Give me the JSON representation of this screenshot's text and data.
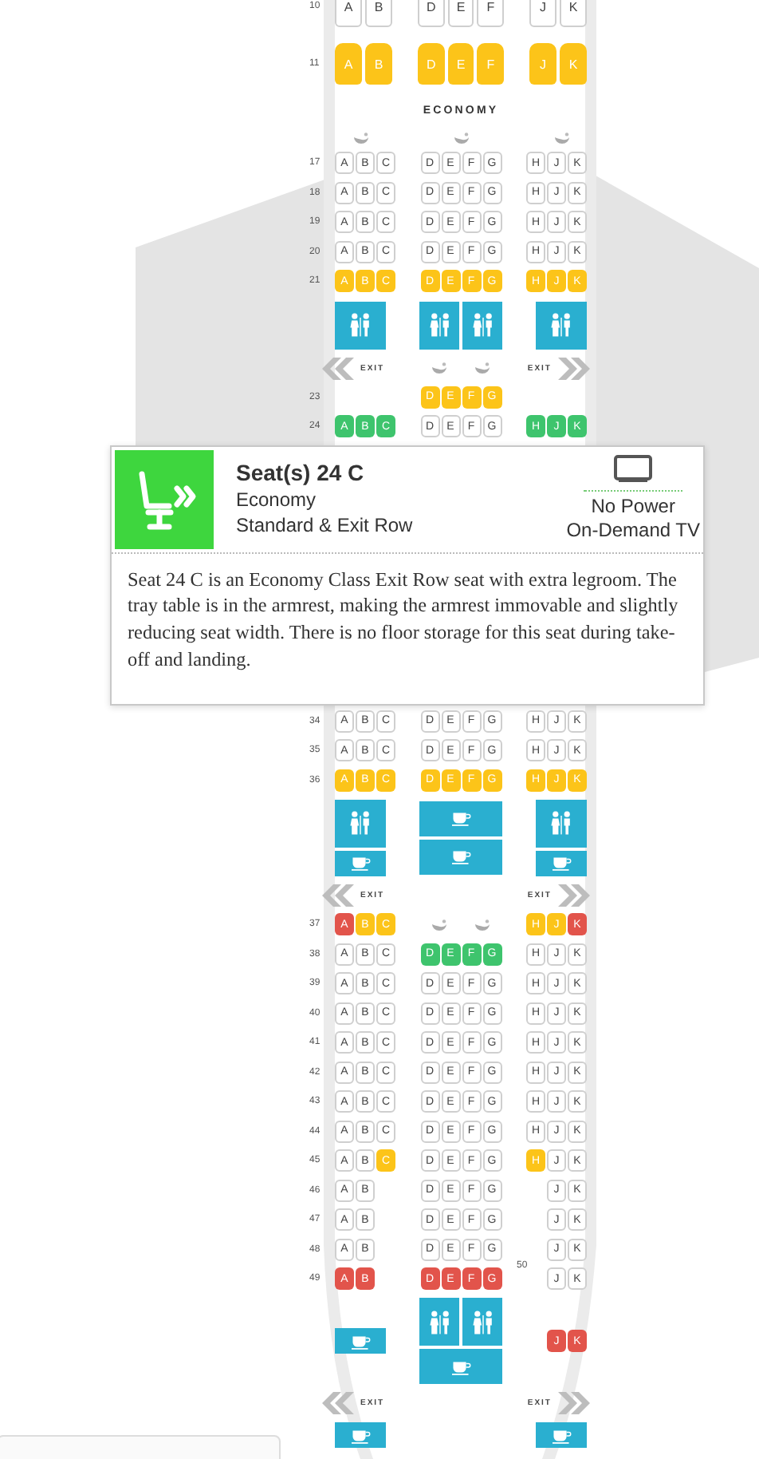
{
  "upper_rows": [
    {
      "kind": "premium",
      "label": "10",
      "left": {
        "seats": [
          {
            "letter": "A",
            "color": "#ffffff"
          },
          {
            "letter": "B",
            "color": "#ffffff"
          }
        ]
      },
      "center": {
        "seats": [
          {
            "letter": "D",
            "color": "#ffffff"
          },
          {
            "letter": "E",
            "color": "#ffffff"
          },
          {
            "letter": "F",
            "color": "#ffffff"
          }
        ]
      },
      "right": {
        "seats": [
          {
            "letter": "J",
            "color": "#ffffff"
          },
          {
            "letter": "K",
            "color": "#ffffff"
          }
        ]
      }
    },
    {
      "kind": "premium",
      "label": "11",
      "left": {
        "seats": [
          {
            "letter": "A",
            "color": "#fcc419"
          },
          {
            "letter": "B",
            "color": "#fcc419"
          }
        ]
      },
      "center": {
        "seats": [
          {
            "letter": "D",
            "color": "#fcc419"
          },
          {
            "letter": "E",
            "color": "#fcc419"
          },
          {
            "letter": "F",
            "color": "#fcc419"
          }
        ]
      },
      "right": {
        "seats": [
          {
            "letter": "J",
            "color": "#fcc419"
          },
          {
            "letter": "K",
            "color": "#fcc419"
          }
        ]
      }
    },
    {
      "kind": "cabin",
      "title": "ECONOMY"
    },
    {
      "kind": "fixtures",
      "left": {
        "blocks": [
          [
            {
              "kind": "bassinet"
            }
          ]
        ]
      },
      "center": {
        "blocks": [
          [
            {
              "kind": "bassinet"
            }
          ]
        ]
      },
      "right": {
        "blocks": [
          [
            {
              "kind": "bassinet"
            }
          ]
        ]
      }
    },
    {
      "kind": "seats",
      "label": "17",
      "left": {
        "seats": [
          {
            "letter": "A",
            "color": "#ffffff"
          },
          {
            "letter": "B",
            "color": "#ffffff"
          },
          {
            "letter": "C",
            "color": "#ffffff"
          }
        ]
      },
      "center": {
        "seats": [
          {
            "letter": "D",
            "color": "#ffffff"
          },
          {
            "letter": "E",
            "color": "#ffffff"
          },
          {
            "letter": "F",
            "color": "#ffffff"
          },
          {
            "letter": "G",
            "color": "#ffffff"
          }
        ]
      },
      "right": {
        "seats": [
          {
            "letter": "H",
            "color": "#ffffff"
          },
          {
            "letter": "J",
            "color": "#ffffff"
          },
          {
            "letter": "K",
            "color": "#ffffff"
          }
        ]
      }
    },
    {
      "kind": "seats",
      "label": "18",
      "left": {
        "seats": [
          {
            "letter": "A",
            "color": "#ffffff"
          },
          {
            "letter": "B",
            "color": "#ffffff"
          },
          {
            "letter": "C",
            "color": "#ffffff"
          }
        ]
      },
      "center": {
        "seats": [
          {
            "letter": "D",
            "color": "#ffffff"
          },
          {
            "letter": "E",
            "color": "#ffffff"
          },
          {
            "letter": "F",
            "color": "#ffffff"
          },
          {
            "letter": "G",
            "color": "#ffffff"
          }
        ]
      },
      "right": {
        "seats": [
          {
            "letter": "H",
            "color": "#ffffff"
          },
          {
            "letter": "J",
            "color": "#ffffff"
          },
          {
            "letter": "K",
            "color": "#ffffff"
          }
        ]
      }
    },
    {
      "kind": "seats",
      "label": "19",
      "left": {
        "seats": [
          {
            "letter": "A",
            "color": "#ffffff"
          },
          {
            "letter": "B",
            "color": "#ffffff"
          },
          {
            "letter": "C",
            "color": "#ffffff"
          }
        ]
      },
      "center": {
        "seats": [
          {
            "letter": "D",
            "color": "#ffffff"
          },
          {
            "letter": "E",
            "color": "#ffffff"
          },
          {
            "letter": "F",
            "color": "#ffffff"
          },
          {
            "letter": "G",
            "color": "#ffffff"
          }
        ]
      },
      "right": {
        "seats": [
          {
            "letter": "H",
            "color": "#ffffff"
          },
          {
            "letter": "J",
            "color": "#ffffff"
          },
          {
            "letter": "K",
            "color": "#ffffff"
          }
        ]
      }
    },
    {
      "kind": "seats",
      "label": "20",
      "left": {
        "seats": [
          {
            "letter": "A",
            "color": "#ffffff"
          },
          {
            "letter": "B",
            "color": "#ffffff"
          },
          {
            "letter": "C",
            "color": "#ffffff"
          }
        ]
      },
      "center": {
        "seats": [
          {
            "letter": "D",
            "color": "#ffffff"
          },
          {
            "letter": "E",
            "color": "#ffffff"
          },
          {
            "letter": "F",
            "color": "#ffffff"
          },
          {
            "letter": "G",
            "color": "#ffffff"
          }
        ]
      },
      "right": {
        "seats": [
          {
            "letter": "H",
            "color": "#ffffff"
          },
          {
            "letter": "J",
            "color": "#ffffff"
          },
          {
            "letter": "K",
            "color": "#ffffff"
          }
        ]
      }
    },
    {
      "kind": "seats",
      "label": "21",
      "left": {
        "seats": [
          {
            "letter": "A",
            "color": "#fcc419"
          },
          {
            "letter": "B",
            "color": "#fcc419"
          },
          {
            "letter": "C",
            "color": "#fcc419"
          }
        ]
      },
      "center": {
        "seats": [
          {
            "letter": "D",
            "color": "#fcc419"
          },
          {
            "letter": "E",
            "color": "#fcc419"
          },
          {
            "letter": "F",
            "color": "#fcc419"
          },
          {
            "letter": "G",
            "color": "#fcc419"
          }
        ]
      },
      "right": {
        "seats": [
          {
            "letter": "H",
            "color": "#fcc419"
          },
          {
            "letter": "J",
            "color": "#fcc419"
          },
          {
            "letter": "K",
            "color": "#fcc419"
          }
        ]
      }
    },
    {
      "kind": "fixtures",
      "left": {
        "blocks": [
          [
            {
              "kind": "lavatory"
            }
          ]
        ]
      },
      "center": {
        "blocks": [
          [
            {
              "kind": "lavatory"
            },
            {
              "kind": "lavatory"
            }
          ]
        ]
      },
      "right": {
        "blocks": [
          [
            {
              "kind": "lavatory"
            }
          ]
        ]
      }
    },
    {
      "kind": "exit",
      "left_text": "EXIT",
      "right_text": "EXIT",
      "center": {
        "blocks": [
          [
            {
              "kind": "bassinet"
            },
            {
              "kind": "bassinet"
            }
          ]
        ]
      }
    },
    {
      "kind": "seats",
      "label": "23",
      "center": {
        "seats": [
          {
            "letter": "D",
            "color": "#fcc419"
          },
          {
            "letter": "E",
            "color": "#fcc419"
          },
          {
            "letter": "F",
            "color": "#fcc419"
          },
          {
            "letter": "G",
            "color": "#fcc419"
          }
        ]
      }
    },
    {
      "kind": "seats",
      "label": "24",
      "left": {
        "seats": [
          {
            "letter": "A",
            "color": "#3ec46d"
          },
          {
            "letter": "B",
            "color": "#3ec46d"
          },
          {
            "letter": "C",
            "color": "#3ec46d"
          }
        ]
      },
      "center": {
        "seats": [
          {
            "letter": "D",
            "color": "#ffffff"
          },
          {
            "letter": "E",
            "color": "#ffffff"
          },
          {
            "letter": "F",
            "color": "#ffffff"
          },
          {
            "letter": "G",
            "color": "#ffffff"
          }
        ]
      },
      "right": {
        "seats": [
          {
            "letter": "H",
            "color": "#3ec46d"
          },
          {
            "letter": "J",
            "color": "#3ec46d"
          },
          {
            "letter": "K",
            "color": "#3ec46d"
          }
        ]
      }
    }
  ],
  "seat_details": {
    "color": "#3ed63e",
    "title": "Seat(s) 24 C",
    "cabin": "Economy",
    "seat_type": "Standard & Exit Row",
    "amenities": [
      "No Power",
      "On-Demand TV"
    ],
    "description": "Seat 24 C is an Economy Class Exit Row seat with extra legroom. The tray table is in the armrest, making the armrest immovable and slightly reducing seat width. There is no floor storage for this seat during take-off and landing."
  },
  "lower_rows": [
    {
      "kind": "seats",
      "label": "34",
      "left": {
        "seats": [
          {
            "letter": "A",
            "color": "#ffffff"
          },
          {
            "letter": "B",
            "color": "#ffffff"
          },
          {
            "letter": "C",
            "color": "#ffffff"
          }
        ]
      },
      "center": {
        "seats": [
          {
            "letter": "D",
            "color": "#ffffff"
          },
          {
            "letter": "E",
            "color": "#ffffff"
          },
          {
            "letter": "F",
            "color": "#ffffff"
          },
          {
            "letter": "G",
            "color": "#ffffff"
          }
        ]
      },
      "right": {
        "seats": [
          {
            "letter": "H",
            "color": "#ffffff"
          },
          {
            "letter": "J",
            "color": "#ffffff"
          },
          {
            "letter": "K",
            "color": "#ffffff"
          }
        ]
      }
    },
    {
      "kind": "seats",
      "label": "35",
      "left": {
        "seats": [
          {
            "letter": "A",
            "color": "#ffffff"
          },
          {
            "letter": "B",
            "color": "#ffffff"
          },
          {
            "letter": "C",
            "color": "#ffffff"
          }
        ]
      },
      "center": {
        "seats": [
          {
            "letter": "D",
            "color": "#ffffff"
          },
          {
            "letter": "E",
            "color": "#ffffff"
          },
          {
            "letter": "F",
            "color": "#ffffff"
          },
          {
            "letter": "G",
            "color": "#ffffff"
          }
        ]
      },
      "right": {
        "seats": [
          {
            "letter": "H",
            "color": "#ffffff"
          },
          {
            "letter": "J",
            "color": "#ffffff"
          },
          {
            "letter": "K",
            "color": "#ffffff"
          }
        ]
      }
    },
    {
      "kind": "seats",
      "label": "36",
      "left": {
        "seats": [
          {
            "letter": "A",
            "color": "#fcc419"
          },
          {
            "letter": "B",
            "color": "#fcc419"
          },
          {
            "letter": "C",
            "color": "#fcc419"
          }
        ]
      },
      "center": {
        "seats": [
          {
            "letter": "D",
            "color": "#fcc419"
          },
          {
            "letter": "E",
            "color": "#fcc419"
          },
          {
            "letter": "F",
            "color": "#fcc419"
          },
          {
            "letter": "G",
            "color": "#fcc419"
          }
        ]
      },
      "right": {
        "seats": [
          {
            "letter": "H",
            "color": "#fcc419"
          },
          {
            "letter": "J",
            "color": "#fcc419"
          },
          {
            "letter": "K",
            "color": "#fcc419"
          }
        ]
      }
    },
    {
      "kind": "fixtures",
      "left": {
        "blocks": [
          [
            {
              "kind": "lavatory"
            }
          ],
          [
            {
              "kind": "galley"
            }
          ]
        ]
      },
      "center": {
        "blocks": [
          [
            {
              "kind": "galley"
            }
          ],
          [
            {
              "kind": "galley"
            }
          ]
        ]
      },
      "right": {
        "blocks": [
          [
            {
              "kind": "lavatory"
            }
          ],
          [
            {
              "kind": "galley"
            }
          ]
        ]
      }
    },
    {
      "kind": "exit",
      "left_text": "EXIT",
      "right_text": "EXIT"
    },
    {
      "kind": "seats",
      "label": "37",
      "left": {
        "seats": [
          {
            "letter": "A",
            "color": "#e2544b"
          },
          {
            "letter": "B",
            "color": "#fcc419"
          },
          {
            "letter": "C",
            "color": "#fcc419"
          }
        ]
      },
      "center": {
        "blocks": [
          [
            {
              "kind": "bassinet"
            },
            {
              "kind": "bassinet"
            }
          ]
        ]
      },
      "right": {
        "seats": [
          {
            "letter": "H",
            "color": "#fcc419"
          },
          {
            "letter": "J",
            "color": "#fcc419"
          },
          {
            "letter": "K",
            "color": "#e2544b"
          }
        ]
      }
    },
    {
      "kind": "seats",
      "label": "38",
      "left": {
        "seats": [
          {
            "letter": "A",
            "color": "#ffffff"
          },
          {
            "letter": "B",
            "color": "#ffffff"
          },
          {
            "letter": "C",
            "color": "#ffffff"
          }
        ]
      },
      "center": {
        "seats": [
          {
            "letter": "D",
            "color": "#3ec46d"
          },
          {
            "letter": "E",
            "color": "#3ec46d"
          },
          {
            "letter": "F",
            "color": "#3ec46d"
          },
          {
            "letter": "G",
            "color": "#3ec46d"
          }
        ]
      },
      "right": {
        "seats": [
          {
            "letter": "H",
            "color": "#ffffff"
          },
          {
            "letter": "J",
            "color": "#ffffff"
          },
          {
            "letter": "K",
            "color": "#ffffff"
          }
        ]
      }
    },
    {
      "kind": "seats",
      "label": "39",
      "left": {
        "seats": [
          {
            "letter": "A",
            "color": "#ffffff"
          },
          {
            "letter": "B",
            "color": "#ffffff"
          },
          {
            "letter": "C",
            "color": "#ffffff"
          }
        ]
      },
      "center": {
        "seats": [
          {
            "letter": "D",
            "color": "#ffffff"
          },
          {
            "letter": "E",
            "color": "#ffffff"
          },
          {
            "letter": "F",
            "color": "#ffffff"
          },
          {
            "letter": "G",
            "color": "#ffffff"
          }
        ]
      },
      "right": {
        "seats": [
          {
            "letter": "H",
            "color": "#ffffff"
          },
          {
            "letter": "J",
            "color": "#ffffff"
          },
          {
            "letter": "K",
            "color": "#ffffff"
          }
        ]
      }
    },
    {
      "kind": "seats",
      "label": "40",
      "left": {
        "seats": [
          {
            "letter": "A",
            "color": "#ffffff"
          },
          {
            "letter": "B",
            "color": "#ffffff"
          },
          {
            "letter": "C",
            "color": "#ffffff"
          }
        ]
      },
      "center": {
        "seats": [
          {
            "letter": "D",
            "color": "#ffffff"
          },
          {
            "letter": "E",
            "color": "#ffffff"
          },
          {
            "letter": "F",
            "color": "#ffffff"
          },
          {
            "letter": "G",
            "color": "#ffffff"
          }
        ]
      },
      "right": {
        "seats": [
          {
            "letter": "H",
            "color": "#ffffff"
          },
          {
            "letter": "J",
            "color": "#ffffff"
          },
          {
            "letter": "K",
            "color": "#ffffff"
          }
        ]
      }
    },
    {
      "kind": "seats",
      "label": "41",
      "left": {
        "seats": [
          {
            "letter": "A",
            "color": "#ffffff"
          },
          {
            "letter": "B",
            "color": "#ffffff"
          },
          {
            "letter": "C",
            "color": "#ffffff"
          }
        ]
      },
      "center": {
        "seats": [
          {
            "letter": "D",
            "color": "#ffffff"
          },
          {
            "letter": "E",
            "color": "#ffffff"
          },
          {
            "letter": "F",
            "color": "#ffffff"
          },
          {
            "letter": "G",
            "color": "#ffffff"
          }
        ]
      },
      "right": {
        "seats": [
          {
            "letter": "H",
            "color": "#ffffff"
          },
          {
            "letter": "J",
            "color": "#ffffff"
          },
          {
            "letter": "K",
            "color": "#ffffff"
          }
        ]
      }
    },
    {
      "kind": "seats",
      "label": "42",
      "left": {
        "seats": [
          {
            "letter": "A",
            "color": "#ffffff"
          },
          {
            "letter": "B",
            "color": "#ffffff"
          },
          {
            "letter": "C",
            "color": "#ffffff"
          }
        ]
      },
      "center": {
        "seats": [
          {
            "letter": "D",
            "color": "#ffffff"
          },
          {
            "letter": "E",
            "color": "#ffffff"
          },
          {
            "letter": "F",
            "color": "#ffffff"
          },
          {
            "letter": "G",
            "color": "#ffffff"
          }
        ]
      },
      "right": {
        "seats": [
          {
            "letter": "H",
            "color": "#ffffff"
          },
          {
            "letter": "J",
            "color": "#ffffff"
          },
          {
            "letter": "K",
            "color": "#ffffff"
          }
        ]
      }
    },
    {
      "kind": "seats",
      "label": "43",
      "left": {
        "seats": [
          {
            "letter": "A",
            "color": "#ffffff"
          },
          {
            "letter": "B",
            "color": "#ffffff"
          },
          {
            "letter": "C",
            "color": "#ffffff"
          }
        ]
      },
      "center": {
        "seats": [
          {
            "letter": "D",
            "color": "#ffffff"
          },
          {
            "letter": "E",
            "color": "#ffffff"
          },
          {
            "letter": "F",
            "color": "#ffffff"
          },
          {
            "letter": "G",
            "color": "#ffffff"
          }
        ]
      },
      "right": {
        "seats": [
          {
            "letter": "H",
            "color": "#ffffff"
          },
          {
            "letter": "J",
            "color": "#ffffff"
          },
          {
            "letter": "K",
            "color": "#ffffff"
          }
        ]
      }
    },
    {
      "kind": "seats",
      "label": "44",
      "left": {
        "seats": [
          {
            "letter": "A",
            "color": "#ffffff"
          },
          {
            "letter": "B",
            "color": "#ffffff"
          },
          {
            "letter": "C",
            "color": "#ffffff"
          }
        ]
      },
      "center": {
        "seats": [
          {
            "letter": "D",
            "color": "#ffffff"
          },
          {
            "letter": "E",
            "color": "#ffffff"
          },
          {
            "letter": "F",
            "color": "#ffffff"
          },
          {
            "letter": "G",
            "color": "#ffffff"
          }
        ]
      },
      "right": {
        "seats": [
          {
            "letter": "H",
            "color": "#ffffff"
          },
          {
            "letter": "J",
            "color": "#ffffff"
          },
          {
            "letter": "K",
            "color": "#ffffff"
          }
        ]
      }
    },
    {
      "kind": "seats",
      "label": "45",
      "left": {
        "seats": [
          {
            "letter": "A",
            "color": "#ffffff"
          },
          {
            "letter": "B",
            "color": "#ffffff"
          },
          {
            "letter": "C",
            "color": "#fcc419"
          }
        ]
      },
      "center": {
        "seats": [
          {
            "letter": "D",
            "color": "#ffffff"
          },
          {
            "letter": "E",
            "color": "#ffffff"
          },
          {
            "letter": "F",
            "color": "#ffffff"
          },
          {
            "letter": "G",
            "color": "#ffffff"
          }
        ]
      },
      "right": {
        "seats": [
          {
            "letter": "H",
            "color": "#fcc419"
          },
          {
            "letter": "J",
            "color": "#ffffff"
          },
          {
            "letter": "K",
            "color": "#ffffff"
          }
        ]
      }
    },
    {
      "kind": "seats",
      "label": "46",
      "left": {
        "seats": [
          {
            "letter": "A",
            "color": "#ffffff"
          },
          {
            "letter": "B",
            "color": "#ffffff"
          }
        ]
      },
      "center": {
        "seats": [
          {
            "letter": "D",
            "color": "#ffffff"
          },
          {
            "letter": "E",
            "color": "#ffffff"
          },
          {
            "letter": "F",
            "color": "#ffffff"
          },
          {
            "letter": "G",
            "color": "#ffffff"
          }
        ]
      },
      "right": {
        "seats": [
          {
            "letter": "J",
            "color": "#ffffff"
          },
          {
            "letter": "K",
            "color": "#ffffff"
          }
        ]
      }
    },
    {
      "kind": "seats",
      "label": "47",
      "left": {
        "seats": [
          {
            "letter": "A",
            "color": "#ffffff"
          },
          {
            "letter": "B",
            "color": "#ffffff"
          }
        ]
      },
      "center": {
        "seats": [
          {
            "letter": "D",
            "color": "#ffffff"
          },
          {
            "letter": "E",
            "color": "#ffffff"
          },
          {
            "letter": "F",
            "color": "#ffffff"
          },
          {
            "letter": "G",
            "color": "#ffffff"
          }
        ]
      },
      "right": {
        "seats": [
          {
            "letter": "J",
            "color": "#ffffff"
          },
          {
            "letter": "K",
            "color": "#ffffff"
          }
        ]
      }
    },
    {
      "kind": "seats",
      "label": "48",
      "left": {
        "seats": [
          {
            "letter": "A",
            "color": "#ffffff"
          },
          {
            "letter": "B",
            "color": "#ffffff"
          }
        ]
      },
      "center": {
        "seats": [
          {
            "letter": "D",
            "color": "#ffffff"
          },
          {
            "letter": "E",
            "color": "#ffffff"
          },
          {
            "letter": "F",
            "color": "#ffffff"
          },
          {
            "letter": "G",
            "color": "#ffffff"
          }
        ]
      },
      "right": {
        "seats": [
          {
            "letter": "J",
            "color": "#ffffff"
          },
          {
            "letter": "K",
            "color": "#ffffff"
          }
        ]
      }
    },
    {
      "kind": "seats",
      "label": "49",
      "left": {
        "seats": [
          {
            "letter": "A",
            "color": "#e2544b"
          },
          {
            "letter": "B",
            "color": "#e2544b"
          }
        ]
      },
      "center": {
        "seats": [
          {
            "letter": "D",
            "color": "#e2544b"
          },
          {
            "letter": "E",
            "color": "#e2544b"
          },
          {
            "letter": "F",
            "color": "#e2544b"
          },
          {
            "letter": "G",
            "color": "#e2544b"
          }
        ]
      },
      "right": {
        "label": "50",
        "seats": [
          {
            "letter": "J",
            "color": "#ffffff"
          },
          {
            "letter": "K",
            "color": "#ffffff"
          }
        ]
      }
    },
    {
      "kind": "fixtures",
      "left": {
        "blocks": [
          [
            {
              "kind": "galley"
            }
          ]
        ]
      },
      "center": {
        "blocks": [
          [
            {
              "kind": "lavatory"
            },
            {
              "kind": "lavatory"
            }
          ],
          [
            {
              "kind": "galley"
            }
          ]
        ]
      },
      "right": {
        "seats": [
          {
            "letter": "J",
            "color": "#e2544b"
          },
          {
            "letter": "K",
            "color": "#e2544b"
          }
        ]
      }
    },
    {
      "kind": "exit",
      "left_text": "EXIT",
      "right_text": "EXIT"
    },
    {
      "kind": "fixtures",
      "left": {
        "blocks": [
          [
            {
              "kind": "galley"
            }
          ]
        ]
      },
      "right": {
        "blocks": [
          [
            {
              "kind": "galley"
            }
          ]
        ]
      }
    }
  ]
}
